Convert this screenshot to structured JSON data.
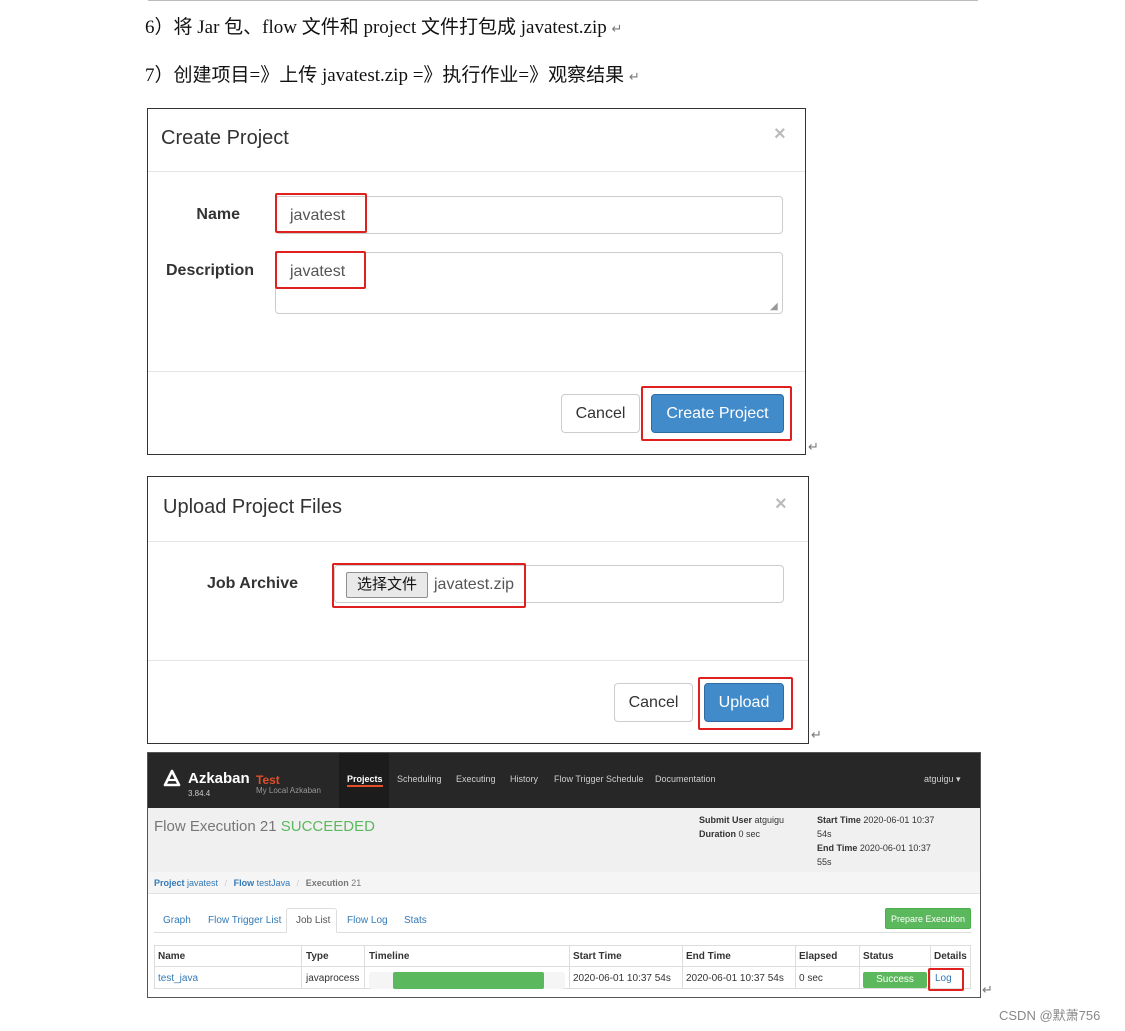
{
  "doc": {
    "step6": "6）将 Jar 包、flow 文件和 project 文件打包成 javatest.zip",
    "step7": "7）创建项目=》上传 javatest.zip =》执行作业=》观察结果",
    "return_mark": "↵"
  },
  "create_dialog": {
    "title": "Create Project",
    "close_glyph": "×",
    "name_label": "Name",
    "name_value": "javatest",
    "description_label": "Description",
    "description_value": "javatest",
    "cancel_label": "Cancel",
    "submit_label": "Create Project"
  },
  "upload_dialog": {
    "title": "Upload Project Files",
    "close_glyph": "×",
    "archive_label": "Job Archive",
    "choose_file_label": "选择文件",
    "file_name": "javatest.zip",
    "cancel_label": "Cancel",
    "submit_label": "Upload"
  },
  "azkaban": {
    "brand": "Azkaban",
    "env": "Test",
    "version": "3.84.4",
    "subtitle": "My Local Azkaban",
    "nav": [
      "Projects",
      "Scheduling",
      "Executing",
      "History",
      "Flow Trigger Schedule",
      "Documentation"
    ],
    "user": "atguigu ▾",
    "execution_title": "Flow Execution 21",
    "execution_status": "SUCCEEDED",
    "submit_user_label": "Submit User",
    "submit_user": "atguigu",
    "duration_label": "Duration",
    "duration": "0 sec",
    "start_time_label": "Start Time",
    "start_time_a": "2020-06-01 10:37",
    "start_time_b": "54s",
    "end_time_label": "End Time",
    "end_time_a": "2020-06-01 10:37",
    "end_time_b": "55s",
    "breadcrumb": {
      "project_label": "Project",
      "project": "javatest",
      "flow_label": "Flow",
      "flow": "testJava",
      "execution_label": "Execution",
      "execution": "21",
      "sep": "/"
    },
    "tabs": [
      "Graph",
      "Flow Trigger List",
      "Job List",
      "Flow Log",
      "Stats"
    ],
    "prepare_label": "Prepare Execution",
    "table": {
      "headers": [
        "Name",
        "Type",
        "Timeline",
        "Start Time",
        "End Time",
        "Elapsed",
        "Status",
        "Details"
      ],
      "row": {
        "name": "test_java",
        "type": "javaprocess",
        "timeline_progress": 0.88,
        "start": "2020-06-01 10:37 54s",
        "end": "2020-06-01 10:37 54s",
        "elapsed": "0 sec",
        "status": "Success",
        "details": "Log"
      }
    }
  },
  "watermark": "CSDN @默萧756",
  "colors": {
    "highlight": "#e0201f",
    "primary": "#428bca",
    "success": "#5cb85c",
    "nav_bg": "#272727"
  }
}
